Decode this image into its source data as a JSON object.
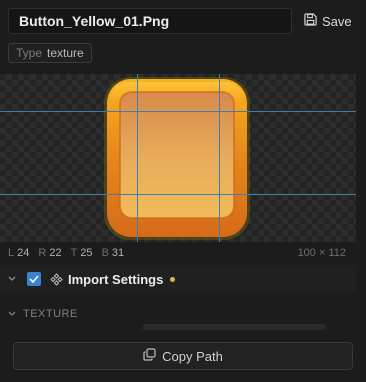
{
  "header": {
    "file_name": "Button_Yellow_01.Png",
    "save_label": "Save"
  },
  "type_chip": {
    "key": "Type",
    "value": "texture"
  },
  "preview": {
    "stats": {
      "l_label": "L",
      "l_value": "24",
      "r_label": "R",
      "r_value": "22",
      "t_label": "T",
      "t_value": "25",
      "b_label": "B",
      "b_value": "31",
      "dimensions": "100 × 112"
    }
  },
  "import_settings": {
    "label": "Import Settings",
    "checked": true,
    "modified_dot_color": "#e7b43a"
  },
  "texture_section": {
    "label": "TEXTURE"
  },
  "footer": {
    "copy_path_label": "Copy Path"
  },
  "colors": {
    "accent_blue": "#3b82d4",
    "guide_blue": "#3d7fb0",
    "button_orange": "#e07f1c",
    "button_yellow": "#f4b12a"
  }
}
